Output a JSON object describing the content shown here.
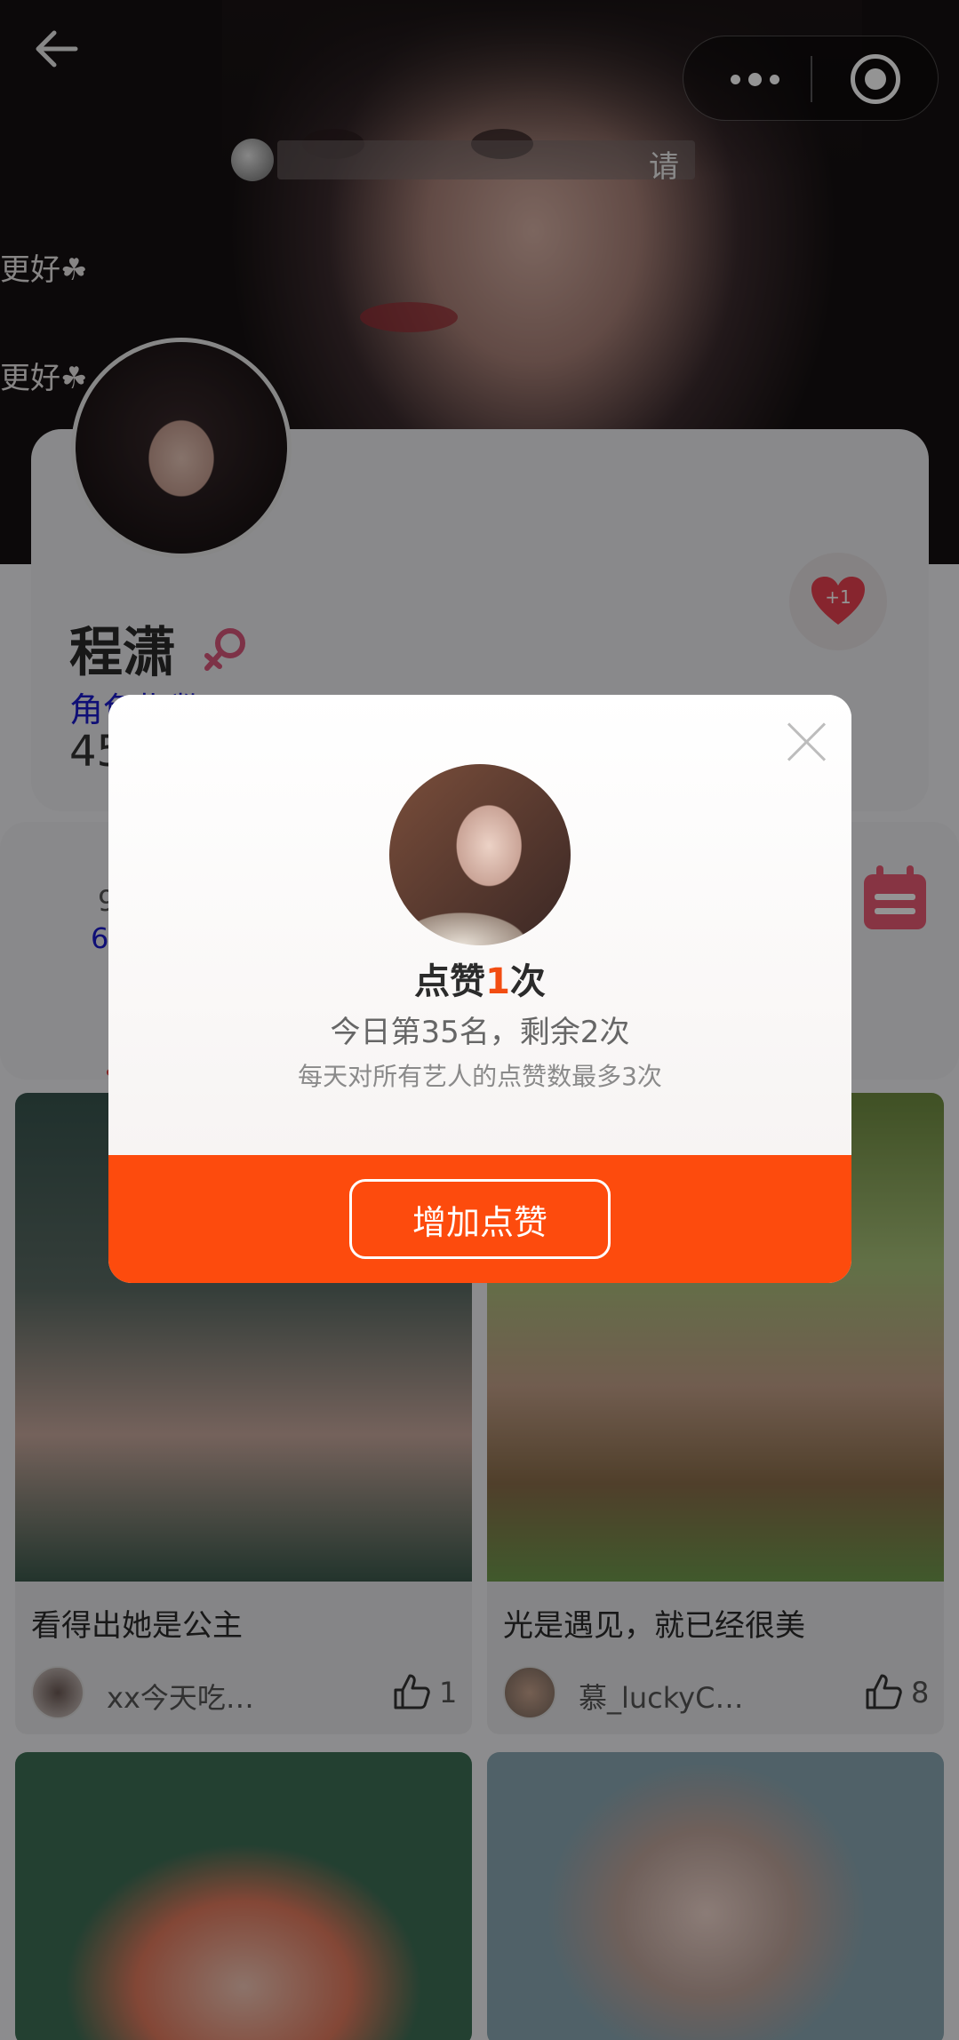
{
  "header": {
    "back_icon": "arrow-left-icon",
    "capsule": {
      "more_icon": "more-dots-icon",
      "close_icon": "target-circle-icon"
    },
    "marquee_tail": "请",
    "danmu": [
      "更好☘",
      "更好☘"
    ]
  },
  "profile": {
    "name": "程潇",
    "gender_icon": "female-icon",
    "index_label": "角色指数 4.56",
    "fans_partial": "45",
    "like_badge": "+1"
  },
  "stats": {
    "line1": "9",
    "line2": "6"
  },
  "feed": [
    {
      "title": "看得出她是公主",
      "user": "xx今天吃…",
      "likes": "1"
    },
    {
      "title": "光是遇见，就已经很美",
      "user": "慕_luckyC…",
      "likes": "8"
    }
  ],
  "dialog": {
    "headline_prefix": "点赞",
    "headline_count": "1",
    "headline_suffix": "次",
    "rank_text": "今日第35名，剩余2次",
    "limit_text": "每天对所有艺人的点赞数最多3次",
    "add_button": "增加点赞",
    "accent_color": "#fd4b0d"
  }
}
